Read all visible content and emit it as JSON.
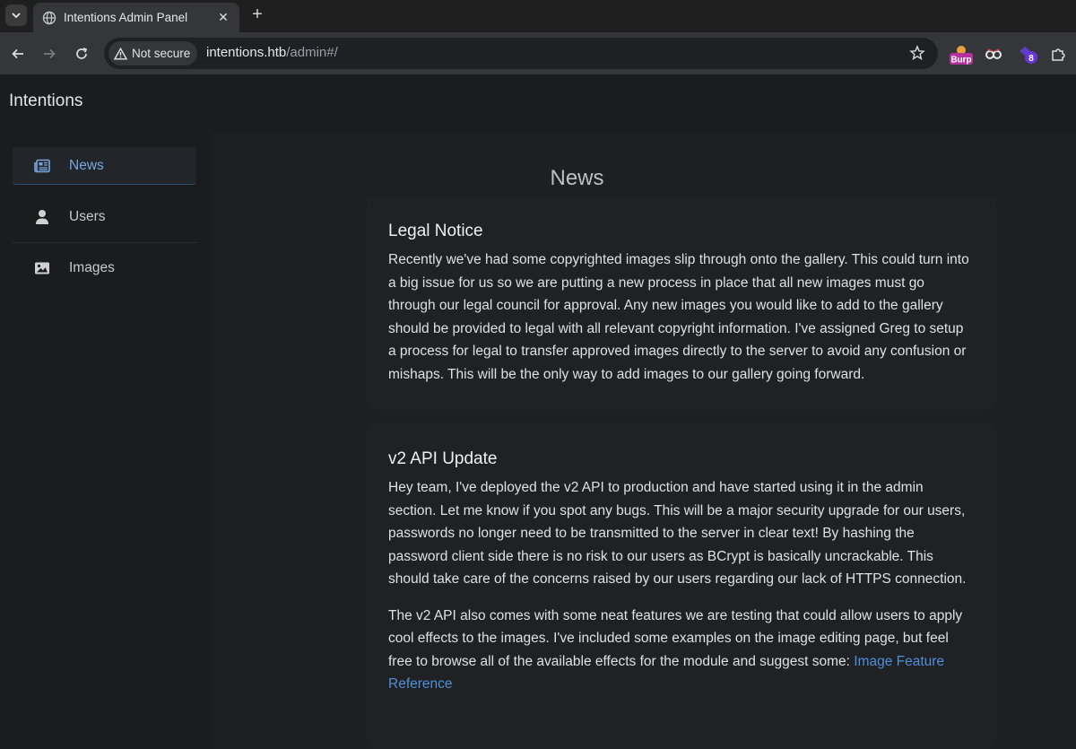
{
  "browser": {
    "tab_title": "Intentions Admin Panel",
    "security_label": "Not secure",
    "url_host": "intentions.htb",
    "url_path": "/admin#/",
    "extensions": [
      {
        "name": "burp-extension-icon",
        "badge": "Burp"
      },
      {
        "name": "glasses-extension-icon",
        "badge": ""
      },
      {
        "name": "wappalyzer-extension-icon",
        "badge": "8"
      }
    ]
  },
  "app": {
    "brand": "Intentions"
  },
  "sidebar": {
    "items": [
      {
        "label": "News",
        "icon": "newspaper-icon",
        "active": true
      },
      {
        "label": "Users",
        "icon": "user-icon",
        "active": false
      },
      {
        "label": "Images",
        "icon": "image-icon",
        "active": false
      }
    ]
  },
  "main": {
    "title": "News",
    "posts": [
      {
        "title": "Legal Notice",
        "paragraphs": [
          "Recently we've had some copyrighted images slip through onto the gallery. This could turn into a big issue for us so we are putting a new process in place that all new images must go through our legal council for approval. Any new images you would like to add to the gallery should be provided to legal with all relevant copyright information. I've assigned Greg to setup a process for legal to transfer approved images directly to the server to avoid any confusion or mishaps. This will be the only way to add images to our gallery going forward."
        ]
      },
      {
        "title": "v2 API Update",
        "paragraphs": [
          "Hey team, I've deployed the v2 API to production and have started using it in the admin section. Let me know if you spot any bugs. This will be a major security upgrade for our users, passwords no longer need to be transmitted to the server in clear text! By hashing the password client side there is no risk to our users as BCrypt is basically uncrackable. This should take care of the concerns raised by our users regarding our lack of HTTPS connection.",
          "The v2 API also comes with some neat features we are testing that could allow users to apply cool effects to the images. I've included some examples on the image editing page, but feel free to browse all of the available effects for the module and suggest some: "
        ],
        "link_text": "Image Feature Reference"
      }
    ]
  }
}
